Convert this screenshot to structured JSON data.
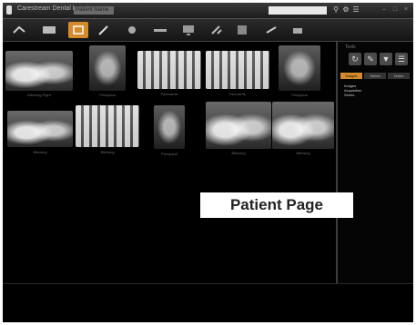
{
  "window": {
    "title": "Carestream Dental Imaging",
    "patient_name": "Patient Name"
  },
  "search": {
    "placeholder": ""
  },
  "toolbar": {
    "tools": [
      {
        "icon": "xray-acquire-icon"
      },
      {
        "icon": "panoramic-icon"
      },
      {
        "icon": "intraoral-icon",
        "active": true
      },
      {
        "icon": "pen-icon"
      },
      {
        "icon": "camera-icon"
      },
      {
        "icon": "ruler-icon"
      },
      {
        "icon": "monitor-icon"
      },
      {
        "icon": "tools-icon"
      },
      {
        "icon": "template-icon"
      },
      {
        "icon": "share-icon"
      },
      {
        "icon": "print-icon"
      }
    ]
  },
  "gallery": {
    "images": [
      {
        "caption": "Bitewing Right",
        "style": "bw"
      },
      {
        "caption": "Periapical",
        "style": "bw3"
      },
      {
        "caption": "Panoramic",
        "style": "bw2"
      },
      {
        "caption": "Panoramic",
        "style": "bw2"
      },
      {
        "caption": "Periapical",
        "style": "bw3"
      },
      {
        "caption": "Bitewing",
        "style": "bw"
      },
      {
        "caption": "Bitewing",
        "style": "bw2"
      },
      {
        "caption": "Periapical",
        "style": "bw3"
      },
      {
        "caption": "Bitewing",
        "style": "bw"
      },
      {
        "caption": "Bitewing",
        "style": "bw"
      }
    ]
  },
  "right_panel": {
    "label": "Tools",
    "icons": [
      "refresh-icon",
      "edit-icon",
      "filter-icon",
      "list-icon"
    ],
    "tabs": [
      {
        "label": "Images",
        "active": true
      },
      {
        "label": "Series",
        "active": false
      },
      {
        "label": "Notes",
        "active": false
      }
    ],
    "tree": [
      "Images",
      "Acquisition",
      "Series"
    ]
  },
  "overlay": {
    "text": "Patient Page"
  }
}
